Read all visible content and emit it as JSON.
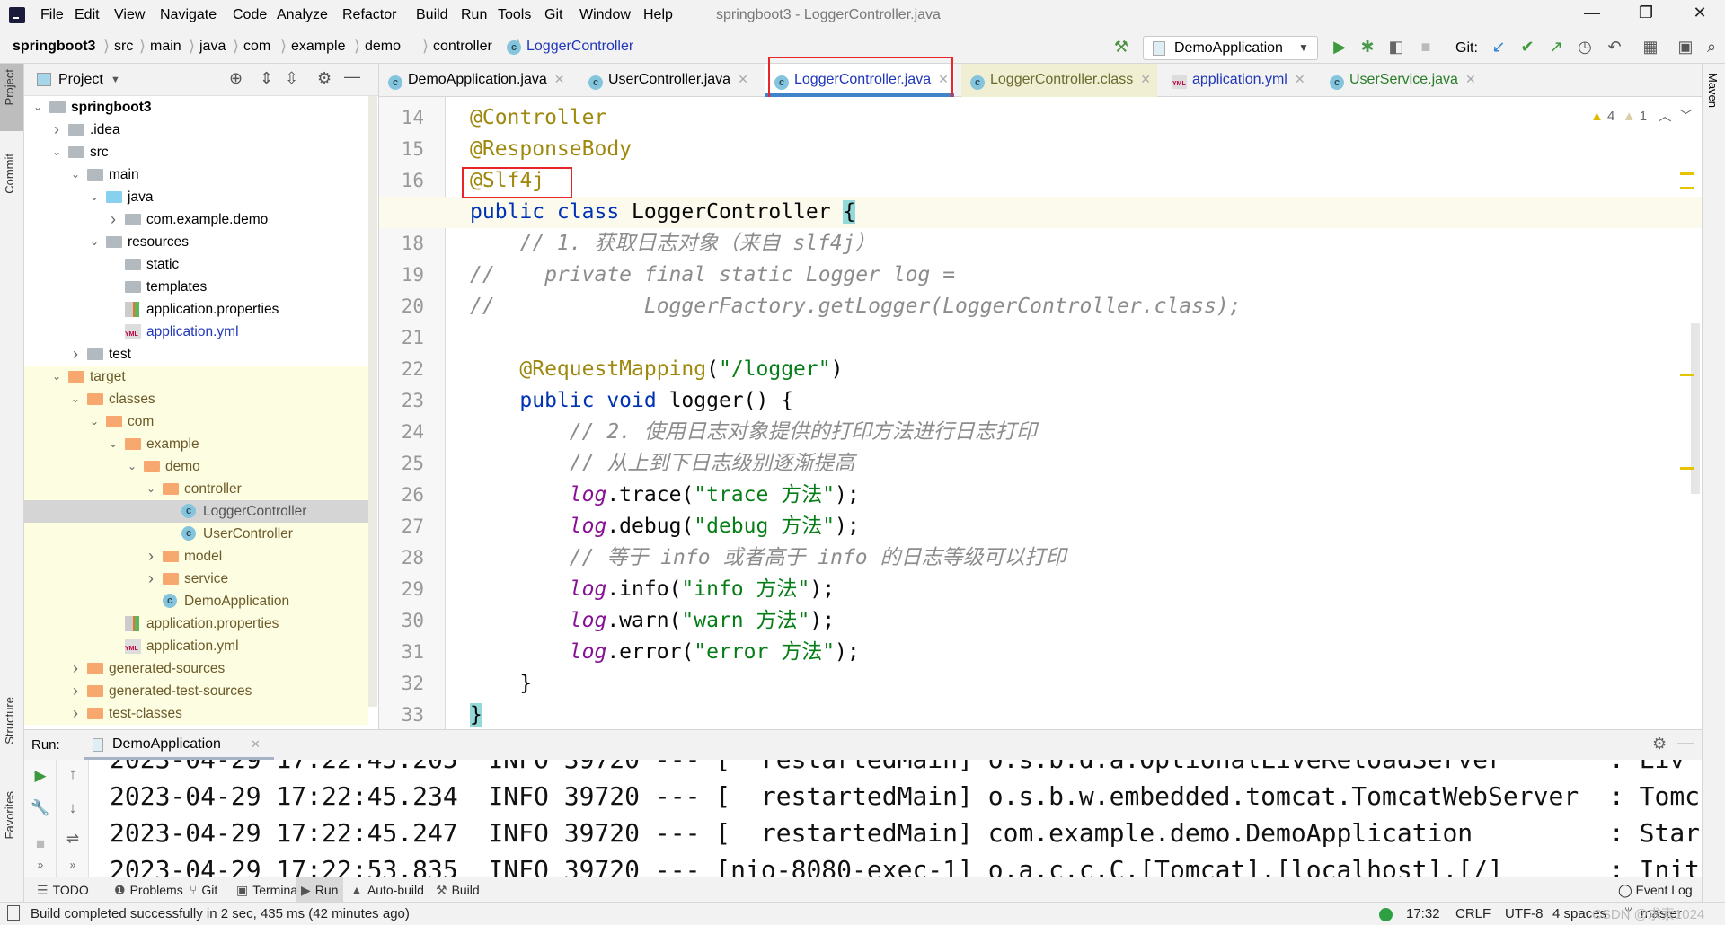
{
  "menu": {
    "items": [
      "File",
      "Edit",
      "View",
      "Navigate",
      "Code",
      "Analyze",
      "Refactor",
      "Build",
      "Run",
      "Tools",
      "Git",
      "Window",
      "Help"
    ],
    "title": "springboot3 - LoggerController.java"
  },
  "breadcrumb": [
    "springboot3",
    "src",
    "main",
    "java",
    "com",
    "example",
    "demo",
    "controller",
    "LoggerController"
  ],
  "toolbar": {
    "run_config": "DemoApplication",
    "git_label": "Git:"
  },
  "project": {
    "title": "Project",
    "tree": [
      {
        "level": 0,
        "label": "springboot3",
        "icon": "module",
        "chev": "down",
        "bold": true
      },
      {
        "level": 1,
        "label": ".idea",
        "icon": "folder",
        "chev": "right"
      },
      {
        "level": 1,
        "label": "src",
        "icon": "folder",
        "chev": "down"
      },
      {
        "level": 2,
        "label": "main",
        "icon": "folder",
        "chev": "down"
      },
      {
        "level": 3,
        "label": "java",
        "icon": "folder-blue",
        "chev": "down"
      },
      {
        "level": 4,
        "label": "com.example.demo",
        "icon": "package",
        "chev": "right"
      },
      {
        "level": 3,
        "label": "resources",
        "icon": "folder",
        "chev": "down"
      },
      {
        "level": 4,
        "label": "static",
        "icon": "folder",
        "chev": ""
      },
      {
        "level": 4,
        "label": "templates",
        "icon": "folder",
        "chev": ""
      },
      {
        "level": 4,
        "label": "application.properties",
        "icon": "properties",
        "chev": ""
      },
      {
        "level": 4,
        "label": "application.yml",
        "icon": "yml",
        "chev": "",
        "color": "#2036b8"
      },
      {
        "level": 2,
        "label": "test",
        "icon": "folder",
        "chev": "right"
      },
      {
        "level": 1,
        "label": "target",
        "icon": "folder-orange",
        "chev": "down",
        "excluded": true
      },
      {
        "level": 2,
        "label": "classes",
        "icon": "folder-orange",
        "chev": "down",
        "excluded": true
      },
      {
        "level": 3,
        "label": "com",
        "icon": "folder-orange",
        "chev": "down",
        "excluded": true
      },
      {
        "level": 4,
        "label": "example",
        "icon": "folder-orange",
        "chev": "down",
        "excluded": true
      },
      {
        "level": 5,
        "label": "demo",
        "icon": "folder-orange",
        "chev": "down",
        "excluded": true
      },
      {
        "level": 6,
        "label": "controller",
        "icon": "folder-orange",
        "chev": "down",
        "excluded": true
      },
      {
        "level": 7,
        "label": "LoggerController",
        "icon": "class",
        "chev": "",
        "excluded": true,
        "selected": true
      },
      {
        "level": 7,
        "label": "UserController",
        "icon": "class",
        "chev": "",
        "excluded": true
      },
      {
        "level": 6,
        "label": "model",
        "icon": "folder-orange",
        "chev": "right",
        "excluded": true
      },
      {
        "level": 6,
        "label": "service",
        "icon": "folder-orange",
        "chev": "right",
        "excluded": true
      },
      {
        "level": 6,
        "label": "DemoApplication",
        "icon": "class",
        "chev": "",
        "excluded": true
      },
      {
        "level": 4,
        "label": "application.properties",
        "icon": "properties",
        "chev": "",
        "excluded": true
      },
      {
        "level": 4,
        "label": "application.yml",
        "icon": "yml",
        "chev": "",
        "excluded": true
      },
      {
        "level": 2,
        "label": "generated-sources",
        "icon": "folder-orange",
        "chev": "right",
        "excluded": true
      },
      {
        "level": 2,
        "label": "generated-test-sources",
        "icon": "folder-orange",
        "chev": "right",
        "excluded": true
      },
      {
        "level": 2,
        "label": "test-classes",
        "icon": "folder-orange",
        "chev": "right",
        "excluded": true
      }
    ]
  },
  "tabs": [
    {
      "label": "DemoApplication.java",
      "icon": "class",
      "color": "#000"
    },
    {
      "label": "UserController.java",
      "icon": "class",
      "color": "#000"
    },
    {
      "label": "LoggerController.java",
      "icon": "class",
      "color": "#2036b8",
      "active": true
    },
    {
      "label": "LoggerController.class",
      "icon": "class",
      "color": "#6b6b30"
    },
    {
      "label": "application.yml",
      "icon": "yml",
      "color": "#2036b8"
    },
    {
      "label": "UserService.java",
      "icon": "class",
      "color": "#2a7d2a"
    }
  ],
  "inspections": {
    "warnings": "4",
    "weak_warnings": "1"
  },
  "code": [
    {
      "n": "14",
      "t": [
        [
          "a",
          "@Controller"
        ]
      ]
    },
    {
      "n": "15",
      "t": [
        [
          "a",
          "@ResponseBody"
        ]
      ]
    },
    {
      "n": "16",
      "t": [
        [
          "a",
          "@Slf4j"
        ]
      ]
    },
    {
      "n": "17",
      "t": [
        [
          "k",
          "public class "
        ],
        [
          "",
          "LoggerController "
        ],
        [
          "br",
          "{"
        ]
      ],
      "current": true
    },
    {
      "n": "18",
      "t": [
        [
          "c",
          "    // 1. 获取日志对象（来自 slf4j）"
        ]
      ]
    },
    {
      "n": "19",
      "t": [
        [
          "c",
          "//    private final static Logger log ="
        ]
      ]
    },
    {
      "n": "20",
      "t": [
        [
          "c",
          "//            LoggerFactory.getLogger(LoggerController.class);"
        ]
      ]
    },
    {
      "n": "21",
      "t": []
    },
    {
      "n": "22",
      "t": [
        [
          "",
          "    "
        ],
        [
          "a",
          "@RequestMapping"
        ],
        [
          "",
          "("
        ],
        [
          "s",
          "\"/logger\""
        ],
        [
          "",
          ")"
        ]
      ]
    },
    {
      "n": "23",
      "t": [
        [
          "k",
          "    public void "
        ],
        [
          "",
          "logger() {"
        ]
      ]
    },
    {
      "n": "24",
      "t": [
        [
          "c",
          "        // 2. 使用日志对象提供的打印方法进行日志打印"
        ]
      ]
    },
    {
      "n": "25",
      "t": [
        [
          "c",
          "        // 从上到下日志级别逐渐提高"
        ]
      ]
    },
    {
      "n": "26",
      "t": [
        [
          "",
          "        "
        ],
        [
          "f",
          "log"
        ],
        [
          "",
          ".trace("
        ],
        [
          "s",
          "\"trace 方法\""
        ],
        [
          "",
          ");"
        ]
      ]
    },
    {
      "n": "27",
      "t": [
        [
          "",
          "        "
        ],
        [
          "f",
          "log"
        ],
        [
          "",
          ".debug("
        ],
        [
          "s",
          "\"debug 方法\""
        ],
        [
          "",
          ");"
        ]
      ]
    },
    {
      "n": "28",
      "t": [
        [
          "c",
          "        // 等于 info 或者高于 info 的日志等级可以打印"
        ]
      ]
    },
    {
      "n": "29",
      "t": [
        [
          "",
          "        "
        ],
        [
          "f",
          "log"
        ],
        [
          "",
          ".info("
        ],
        [
          "s",
          "\"info 方法\""
        ],
        [
          "",
          ");"
        ]
      ]
    },
    {
      "n": "30",
      "t": [
        [
          "",
          "        "
        ],
        [
          "f",
          "log"
        ],
        [
          "",
          ".warn("
        ],
        [
          "s",
          "\"warn 方法\""
        ],
        [
          "",
          ");"
        ]
      ]
    },
    {
      "n": "31",
      "t": [
        [
          "",
          "        "
        ],
        [
          "f",
          "log"
        ],
        [
          "",
          ".error("
        ],
        [
          "s",
          "\"error 方法\""
        ],
        [
          "",
          ");"
        ]
      ]
    },
    {
      "n": "32",
      "t": [
        [
          "",
          "    }"
        ]
      ]
    },
    {
      "n": "33",
      "t": [
        [
          "br",
          "}"
        ]
      ]
    }
  ],
  "run": {
    "label": "Run:",
    "tab": "DemoApplication",
    "console": [
      "2023-04-29 17:22:45.205  INFO 39720 --- [  restartedMain] o.s.b.d.a.OptionalLiveReloadServer       : Liv",
      "2023-04-29 17:22:45.234  INFO 39720 --- [  restartedMain] o.s.b.w.embedded.tomcat.TomcatWebServer  : Tomc",
      "2023-04-29 17:22:45.247  INFO 39720 --- [  restartedMain] com.example.demo.DemoApplication         : Star",
      "2023-04-29 17:22:53.835  INFO 39720 --- [nio-8080-exec-1] o.a.c.c.C.[Tomcat].[localhost].[/]       : Init"
    ]
  },
  "side_tabs": {
    "project": "Project",
    "commit": "Commit",
    "structure": "Structure",
    "favorites": "Favorites",
    "maven": "Maven"
  },
  "bottom_tabs": [
    "TODO",
    "Problems",
    "Git",
    "Terminal",
    "Run",
    "Auto-build",
    "Build"
  ],
  "event_log": "Event Log",
  "status": {
    "message": "Build completed successfully in 2 sec, 435 ms (42 minutes ago)",
    "position": "17:32",
    "line_sep": "CRLF",
    "encoding": "UTF-8",
    "indent": "4 spaces",
    "branch": "master",
    "watermark": "CSDN @求索1024"
  }
}
